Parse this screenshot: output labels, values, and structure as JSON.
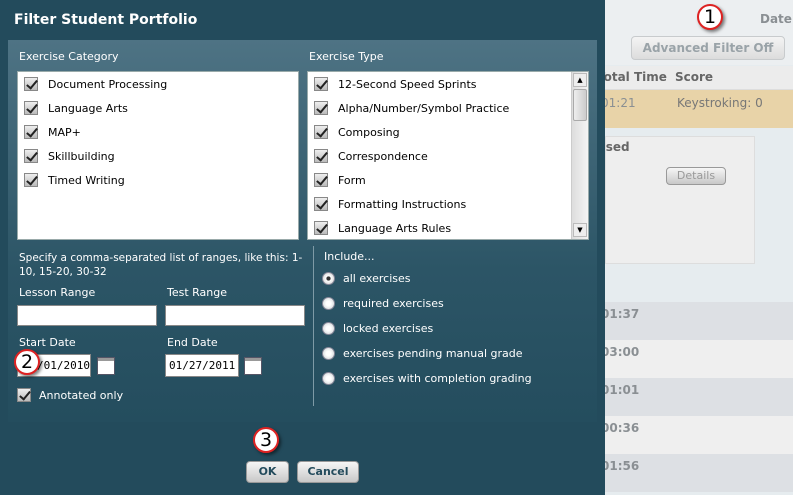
{
  "background": {
    "date_label": "Date:",
    "advanced_filter_button": "Advanced Filter Off",
    "columns": [
      "Total Time",
      "Score"
    ],
    "highlight_row": {
      "time": "01:21",
      "score": "Keystroking: 0"
    },
    "sub_header": "Used",
    "details_button": "Details",
    "times": [
      "01:37",
      "03:00",
      "01:01",
      "00:36",
      "01:56"
    ]
  },
  "dialog": {
    "title": "Filter Student Portfolio",
    "exercise_category": {
      "label": "Exercise Category",
      "items": [
        "Document Processing",
        "Language Arts",
        "MAP+",
        "Skillbuilding",
        "Timed Writing"
      ]
    },
    "exercise_type": {
      "label": "Exercise Type",
      "items": [
        "12-Second Speed Sprints",
        "Alpha/Number/Symbol Practice",
        "Composing",
        "Correspondence",
        "Form",
        "Formatting Instructions",
        "Language Arts Rules"
      ]
    },
    "range_hint": "Specify a comma-separated list of ranges, like this: 1-10, 15-20, 30-32",
    "lesson_range": {
      "label": "Lesson Range",
      "value": ""
    },
    "test_range": {
      "label": "Test Range",
      "value": ""
    },
    "start_date": {
      "label": "Start Date",
      "value": "01/01/2010"
    },
    "end_date": {
      "label": "End Date",
      "value": "01/27/2011"
    },
    "annotated_only": {
      "label": "Annotated only",
      "checked": true
    },
    "include": {
      "label": "Include...",
      "selected": "all exercises",
      "options": [
        "all exercises",
        "required exercises",
        "locked exercises",
        "exercises pending manual grade",
        "exercises with completion grading"
      ]
    },
    "ok": "OK",
    "cancel": "Cancel"
  },
  "callouts": [
    "1",
    "2",
    "3"
  ],
  "colors": {
    "dialog": "#234b5c",
    "highlight": "#e8d3a8",
    "callout_border": "#dd2222"
  }
}
